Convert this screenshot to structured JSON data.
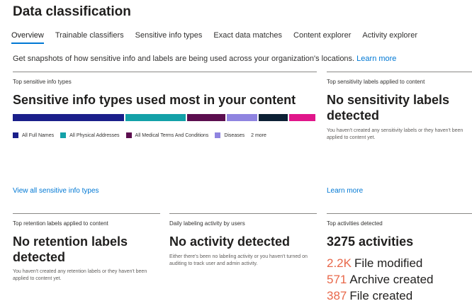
{
  "page": {
    "title": "Data classification"
  },
  "tabs": [
    {
      "label": "Overview",
      "active": true
    },
    {
      "label": "Trainable classifiers",
      "active": false
    },
    {
      "label": "Sensitive info types",
      "active": false
    },
    {
      "label": "Exact data matches",
      "active": false
    },
    {
      "label": "Content explorer",
      "active": false
    },
    {
      "label": "Activity explorer",
      "active": false
    }
  ],
  "intro": {
    "text": "Get snapshots of how sensitive info and labels are being used across your organization's locations.",
    "link": "Learn more"
  },
  "sensitive_info": {
    "header": "Top sensitive info types",
    "title": "Sensitive info types used most in your content",
    "segments": [
      {
        "color": "#1a1f8a",
        "share": 0.37
      },
      {
        "color": "#13a1a8",
        "share": 0.205
      },
      {
        "color": "#5c0e4f",
        "share": 0.13
      },
      {
        "color": "#8f84e0",
        "share": 0.105
      },
      {
        "color": "#0d2135",
        "share": 0.1
      },
      {
        "color": "#e0168a",
        "share": 0.09
      }
    ],
    "legend": [
      {
        "label": "All Full Names",
        "color": "#1a1f8a"
      },
      {
        "label": "All Physical Addresses",
        "color": "#13a1a8"
      },
      {
        "label": "All Medical Terms And Conditions",
        "color": "#5c0e4f"
      },
      {
        "label": "Diseases",
        "color": "#8f84e0"
      }
    ],
    "more": "2 more",
    "link": "View all sensitive info types"
  },
  "sensitivity_labels": {
    "header": "Top sensitivity labels applied to content",
    "title": "No sensitivity labels detected",
    "desc": "You haven't created any sensitivity labels or they haven't been applied to content yet.",
    "link": "Learn more"
  },
  "retention_labels": {
    "header": "Top retention labels applied to content",
    "title": "No retention labels detected",
    "desc": "You haven't created any retention labels or they haven't been applied to content yet."
  },
  "daily_labeling": {
    "header": "Daily labeling activity by users",
    "title": "No activity detected",
    "desc": "Either there's been no labeling activity or you haven't turned on auditing to track user and admin activity."
  },
  "top_activities": {
    "header": "Top activities detected",
    "title": "3275 activities",
    "rows": [
      {
        "count": "2.2K",
        "label": "File modified"
      },
      {
        "count": "571",
        "label": "Archive created"
      },
      {
        "count": "387",
        "label": "File created"
      }
    ]
  }
}
